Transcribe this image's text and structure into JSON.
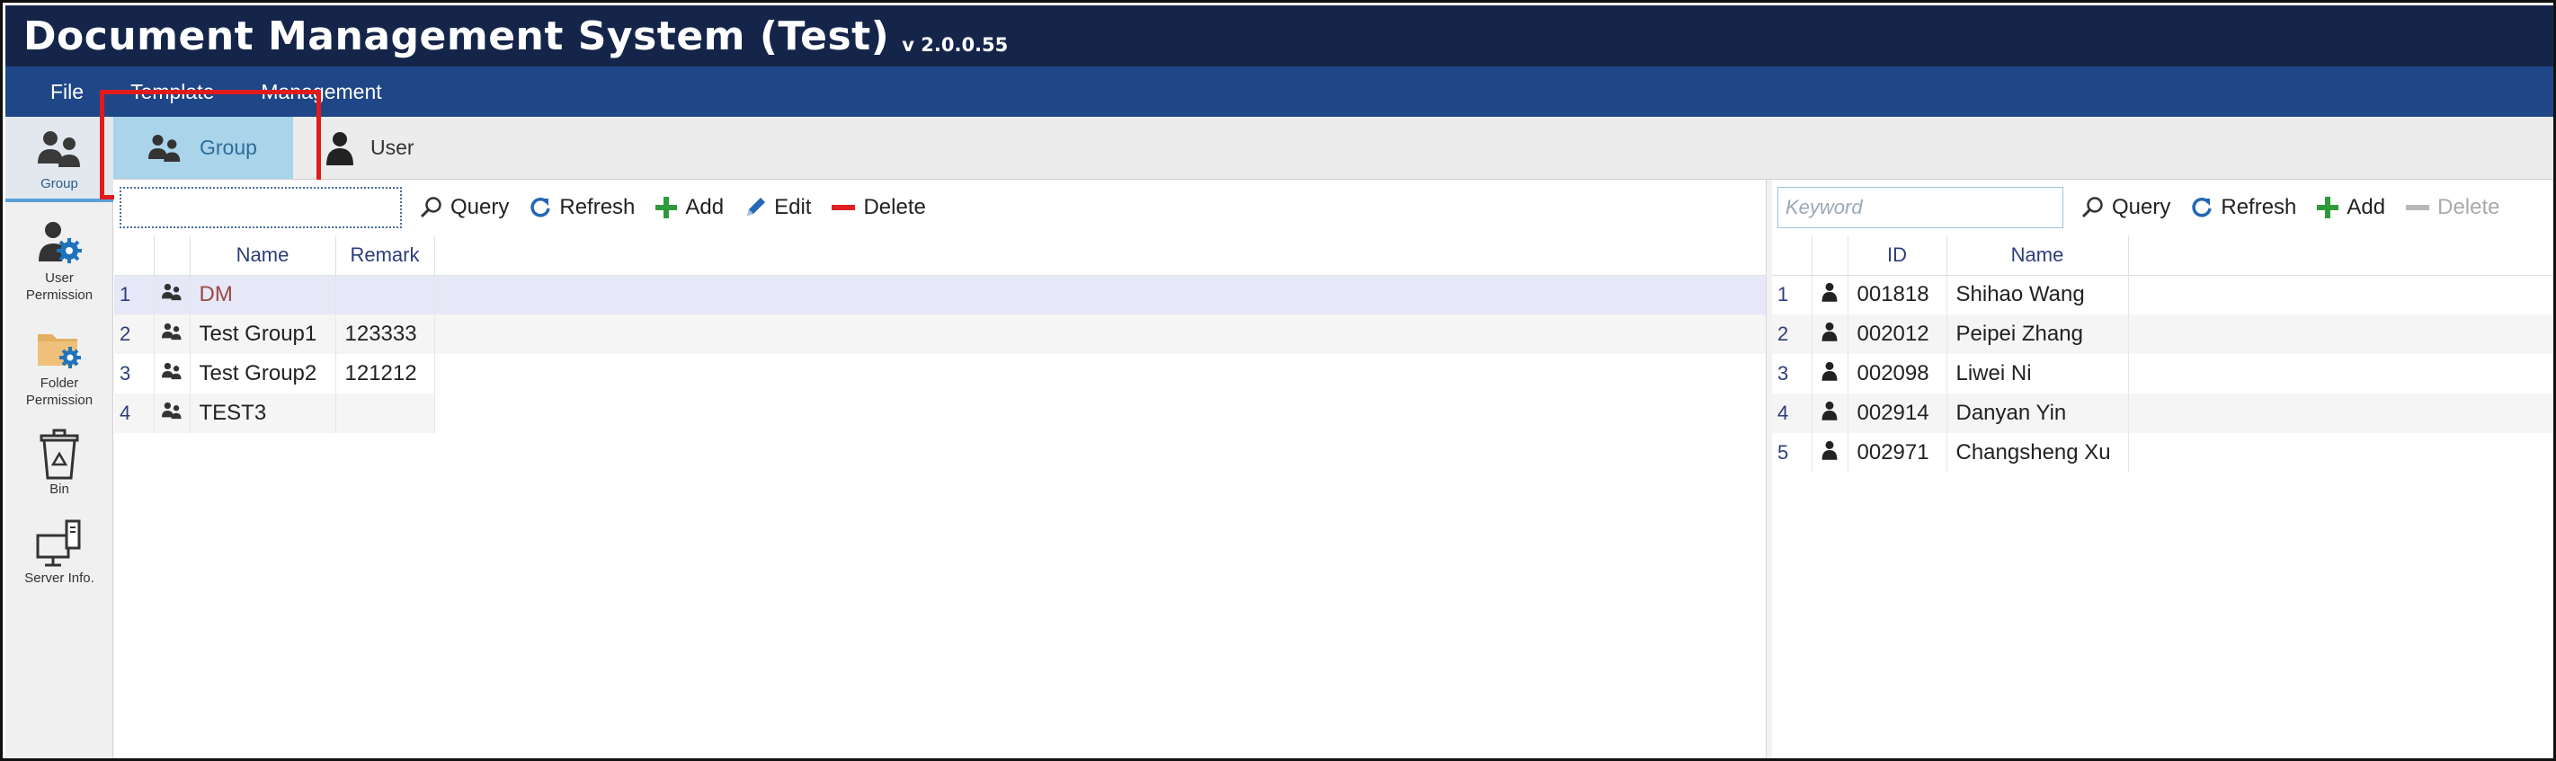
{
  "app": {
    "title": "Document Management System (Test)",
    "version": "v 2.0.0.55"
  },
  "menu": [
    "File",
    "Template",
    "Management"
  ],
  "sidebar": {
    "items": [
      {
        "label": "Group",
        "icon": "group-icon",
        "active": true
      },
      {
        "label": "User\nPermission",
        "icon": "user-permission-icon",
        "active": false
      },
      {
        "label": "Folder\nPermission",
        "icon": "folder-permission-icon",
        "active": false
      },
      {
        "label": "Bin",
        "icon": "recycle-bin-icon",
        "active": false
      },
      {
        "label": "Server Info.",
        "icon": "server-icon",
        "active": false
      }
    ]
  },
  "subtabs": [
    {
      "label": "Group",
      "icon": "group-icon",
      "active": true
    },
    {
      "label": "User",
      "icon": "user-icon",
      "active": false
    }
  ],
  "left_panel": {
    "search_value": "",
    "toolbar": {
      "query": "Query",
      "refresh": "Refresh",
      "add": "Add",
      "edit": "Edit",
      "delete": "Delete"
    },
    "columns": [
      "Name",
      "Remark"
    ],
    "rows": [
      {
        "n": "1",
        "name": "DM",
        "remark": ""
      },
      {
        "n": "2",
        "name": "Test Group1",
        "remark": "123333"
      },
      {
        "n": "3",
        "name": "Test Group2",
        "remark": "121212"
      },
      {
        "n": "4",
        "name": "TEST3",
        "remark": ""
      }
    ]
  },
  "right_panel": {
    "search_placeholder": "Keyword",
    "toolbar": {
      "query": "Query",
      "refresh": "Refresh",
      "add": "Add",
      "delete": "Delete"
    },
    "columns": [
      "ID",
      "Name"
    ],
    "rows": [
      {
        "n": "1",
        "id": "001818",
        "name": "Shihao Wang"
      },
      {
        "n": "2",
        "id": "002012",
        "name": "Peipei Zhang"
      },
      {
        "n": "3",
        "id": "002098",
        "name": "Liwei Ni"
      },
      {
        "n": "4",
        "id": "002914",
        "name": "Danyan Yin"
      },
      {
        "n": "5",
        "id": "002971",
        "name": "Changsheng Xu"
      }
    ]
  },
  "colors": {
    "title_bar": "#15254a",
    "menu_bar": "#1f4687",
    "active_tab": "#a9d4e9",
    "highlight": "#e11b1b",
    "add_green": "#2e9a3a",
    "delete_red": "#e02020",
    "refresh_blue": "#2467b4"
  }
}
